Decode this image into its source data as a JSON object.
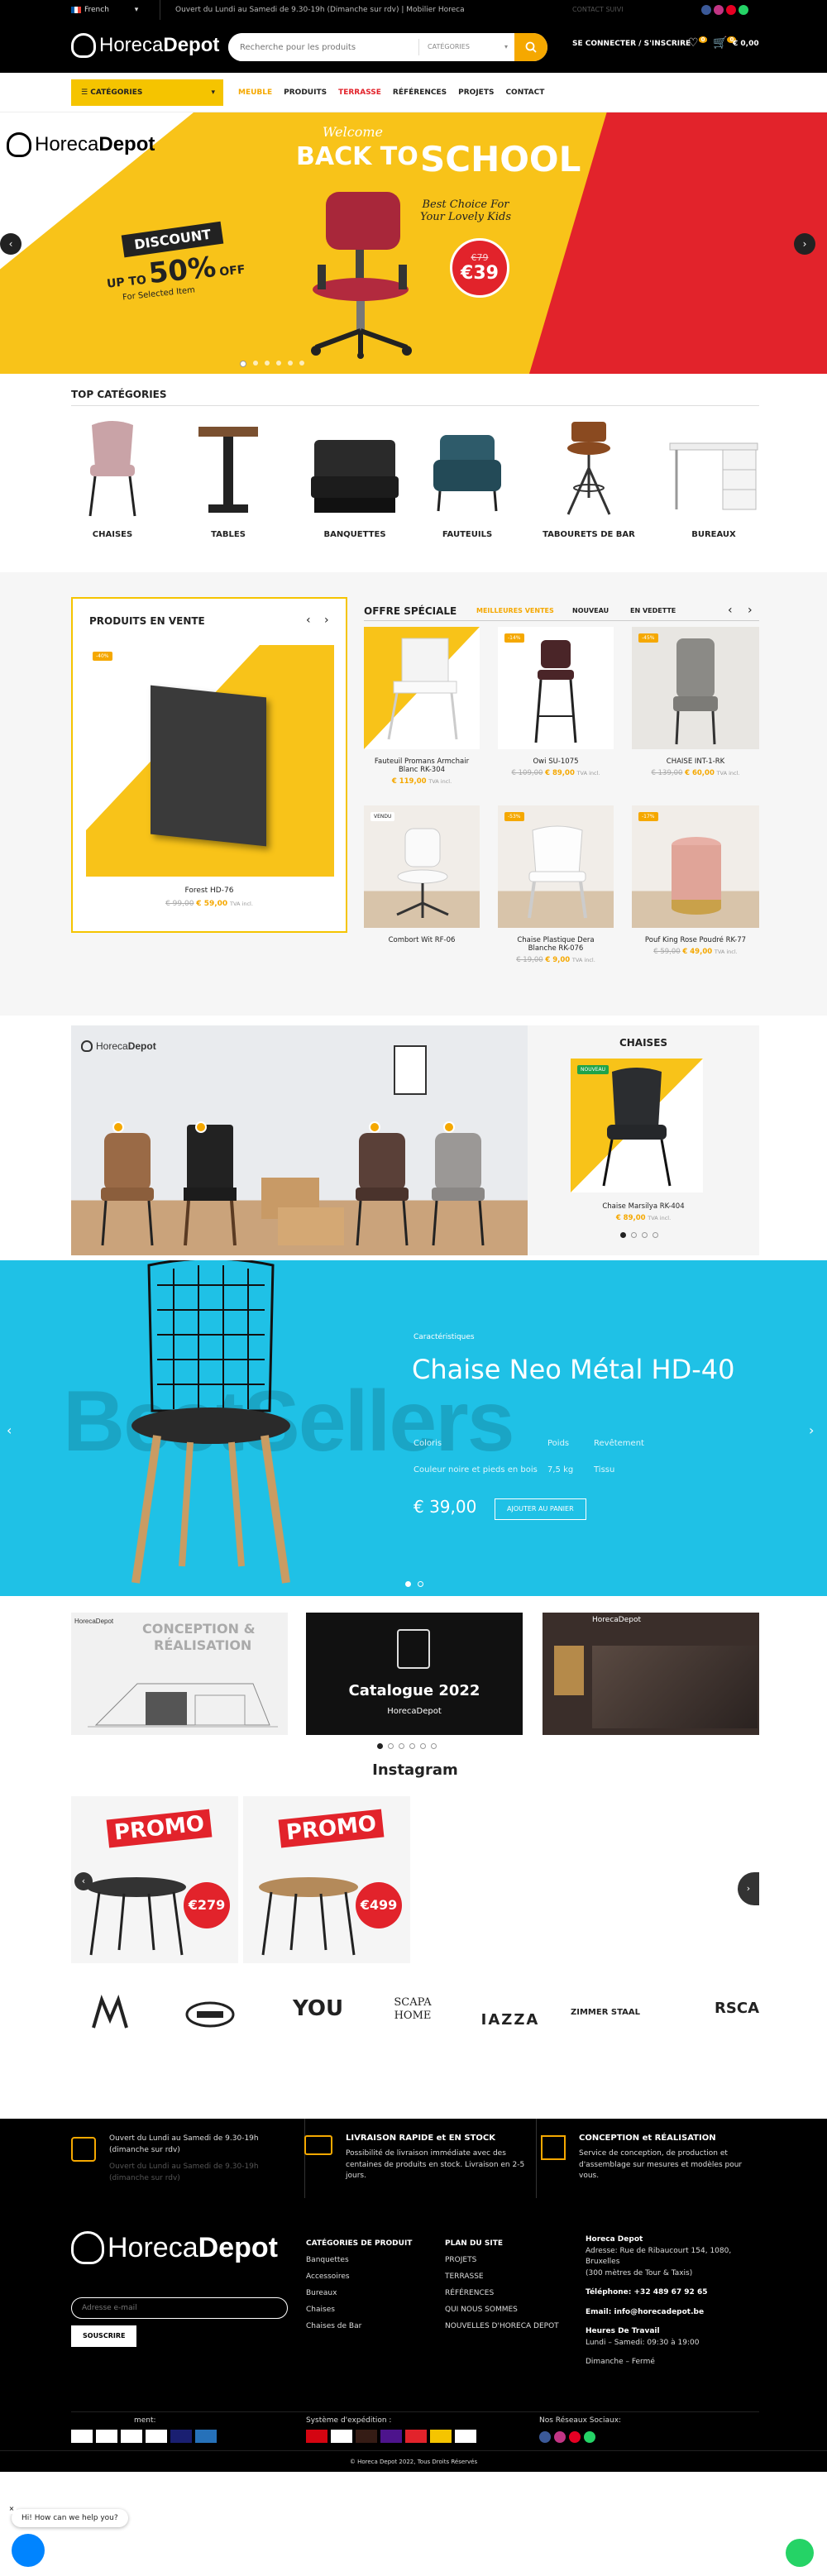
{
  "topbar": {
    "language": "French",
    "hours": "Ouvert du Lundi au Samedi de 9.30-19h (Dimanche sur rdv) | Mobilier Horeca",
    "links": "CONTACT   SUIVI"
  },
  "header": {
    "logo_a": "Horeca",
    "logo_b": "Depot",
    "search_placeholder": "Recherche pour les produits",
    "search_category": "CATÉGORIES",
    "account": "SE CONNECTER / S'INSCRIRE",
    "wishlist_count": "0",
    "cart_count": "0",
    "cart_total": "€ 0,00"
  },
  "nav": {
    "categories": "CATÉGORIES",
    "links": [
      "MEUBLE",
      "PRODUITS",
      "TERRASSE",
      "RÉFÉRENCES",
      "PROJETS",
      "CONTACT"
    ]
  },
  "hero": {
    "welcome": "Welcome",
    "title_a": "BACK TO",
    "title_b": "SCHOOL",
    "tagline": "Best Choice For Your Lovely Kids",
    "discount": "DISCOUNT",
    "upto": "UP TO",
    "pct": "50%",
    "off": "OFF",
    "selected": "For Selected Item",
    "old_price": "€79",
    "new_price": "€39"
  },
  "top_categories": {
    "title": "TOP CATÉGORIES",
    "items": [
      "CHAISES",
      "TABLES",
      "BANQUETTES",
      "FAUTEUILS",
      "TABOURETS DE BAR",
      "BUREAUX"
    ]
  },
  "on_sale": {
    "title": "PRODUITS EN VENTE",
    "badge": "-40%",
    "name": "Forest HD-76",
    "old": "€ 99,00",
    "new": "€ 59,00",
    "tax": "TVA incl."
  },
  "special": {
    "title": "OFFRE SPÉCIALE",
    "tabs": [
      "MEILLEURES VENTES",
      "NOUVEAU",
      "EN VEDETTE"
    ],
    "products": [
      {
        "name": "Fauteuil Promans Armchair Blanc RK-304",
        "badge": "",
        "old": "",
        "new": "€ 119,00",
        "tax": "TVA incl."
      },
      {
        "name": "Owi SU-1075",
        "badge": "-14%",
        "old": "€ 109,00",
        "new": "€ 89,00",
        "tax": "TVA incl."
      },
      {
        "name": "CHAISE INT-1-RK",
        "badge": "-45%",
        "old": "€ 139,00",
        "new": "€ 60,00",
        "tax": "TVA incl."
      },
      {
        "name": "Combort Wit RF-06",
        "badge": "VENDU",
        "old": "",
        "new": "",
        "tax": ""
      },
      {
        "name": "Chaise Plastique Dera Blanche RK-076",
        "badge": "-53%",
        "old": "€ 19,00",
        "new": "€ 9,00",
        "tax": "TVA incl."
      },
      {
        "name": "Pouf King Rose Poudré RK-77",
        "badge": "-17%",
        "old": "€ 59,00",
        "new": "€ 49,00",
        "tax": "TVA incl."
      }
    ]
  },
  "chaises_box": {
    "title": "CHAISES",
    "badge": "NOUVEAU",
    "name": "Chaise Marsilya RK-404",
    "price": "€ 89,00",
    "tax": "TVA incl."
  },
  "bestseller": {
    "watermark": "BestSellers",
    "eyebrow": "Caractéristiques",
    "name": "Chaise Neo Métal HD-40",
    "spec_labels": [
      "Coloris",
      "Poids",
      "Revêtement"
    ],
    "spec_values": [
      "Couleur noire et pieds en bois",
      "7,5 kg",
      "Tissu"
    ],
    "price": "€ 39,00",
    "cta": "AJOUTER AU PANIER"
  },
  "banners": {
    "concept_a": "CONCEPTION &",
    "concept_b": "RÉALISATION",
    "catalogue": "Catalogue 2022",
    "logo": "HorecaDepot"
  },
  "instagram": {
    "title": "Instagram",
    "promo": "PROMO",
    "p1": "€279",
    "p2": "€499"
  },
  "brands": [
    "YOU",
    "SCAPA HOME",
    "IAZZA",
    "ZIMMER STAAL",
    "RSCA"
  ],
  "features": [
    {
      "title": "",
      "line1": "Ouvert du Lundi au Samedi de 9.30-19h (dimanche sur rdv)",
      "line2": "Ouvert du Lundi au Samedi de 9.30-19h (dimanche sur rdv)"
    },
    {
      "title": "LIVRAISON RAPIDE et EN STOCK",
      "line1": "Possibilité de livraison immédiate avec des centaines de produits en stock. Livraison en 2-5 jours.",
      "line2": ""
    },
    {
      "title": "CONCEPTION et RÉALISATION",
      "line1": "Service de conception, de production et d'assemblage sur mesures et modèles pour vous.",
      "line2": ""
    }
  ],
  "footer": {
    "newsletter_placeholder": "Adresse e-mail",
    "subscribe": "SOUSCRIRE",
    "col1_title": "CATÉGORIES DE PRODUIT",
    "col1": [
      "Banquettes",
      "Accessoires",
      "Bureaux",
      "Chaises",
      "Chaises de Bar"
    ],
    "col2_title": "PLAN DU SITE",
    "col2": [
      "PROJETS",
      "TERRASSE",
      "RÉFÉRENCES",
      "QUI NOUS SOMMES",
      "NOUVELLES D'HORECA DEPOT"
    ],
    "company": "Horeca Depot",
    "address": "Adresse: Rue de Ribaucourt 154, 1080, Bruxelles",
    "surface": "(300 mètres de Tour & Taxis)",
    "phone": "Téléphone: +32 489 67 92 65",
    "email": "Email: info@horecadepot.be",
    "hours_title": "Heures De Travail",
    "hours1": "Lundi – Samedi: 09:30 à 19:00",
    "hours2": "Dimanche – Fermé",
    "payment_label": "ment:",
    "shipping_label": "Système d'expédition :",
    "social_label": "Nos Réseaux Sociaux:",
    "copyright": "© Horeca Depot 2022, Tous Droits Réservés",
    "chat": "Hi! How can we help you?"
  },
  "colors": {
    "accent": "#f5a800",
    "yellow": "#f8c319",
    "red": "#e2232b",
    "cyan": "#1fc1e6"
  }
}
